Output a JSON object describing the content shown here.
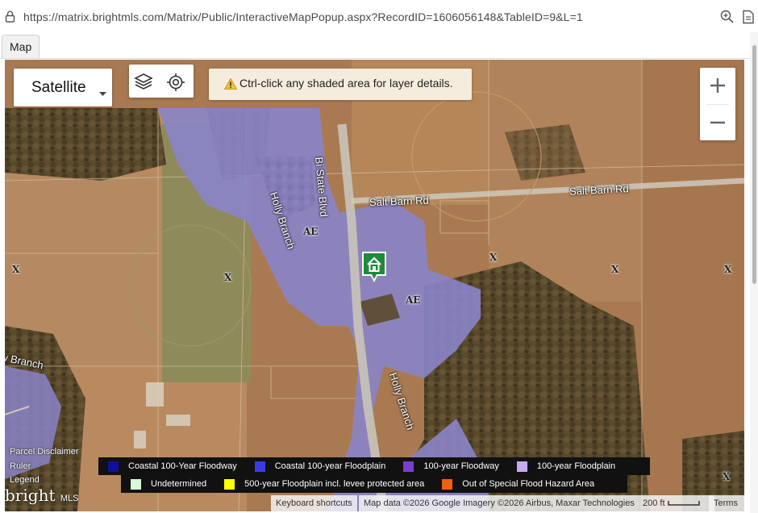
{
  "browser": {
    "url": "https://matrix.brightmls.com/Matrix/Public/InteractiveMapPopup.aspx?RecordID=1606056148&TableID=9&L=1"
  },
  "tabs": [
    {
      "label": "Map",
      "active": true
    }
  ],
  "map": {
    "type_control": {
      "selected": "Satellite"
    },
    "hint": "Ctrl-click any shaded area for layer details.",
    "road_labels": {
      "bi_state": "Bi State Blvd",
      "salt_barn": "Salt Barn Rd",
      "holly_upper": "Holly Branch",
      "holly_lower": "Holly Branch",
      "west_branch": "w Branch"
    },
    "zones": {
      "ae1": "AE",
      "ae2": "AE",
      "x1": "X",
      "x2": "X",
      "x3": "X",
      "x4": "X",
      "x5": "X",
      "x6": "X"
    },
    "side_links": {
      "parcel_disclaimer": "Parcel Disclaimer",
      "ruler": "Ruler",
      "legend": "Legend"
    },
    "legend": [
      {
        "label": "Coastal 100-Year Floodway",
        "color": "#1010a0"
      },
      {
        "label": "Coastal 100-year Floodplain",
        "color": "#3a3ae8"
      },
      {
        "label": "100-year Floodway",
        "color": "#7a3ed0"
      },
      {
        "label": "100-year Floodplain",
        "color": "#c8a8f0"
      },
      {
        "label": "Undetermined",
        "color": "#d8f8d8"
      },
      {
        "label": "500-year Floodplain incl. levee protected area",
        "color": "#ffff00"
      },
      {
        "label": "Out of Special Flood Hazard Area",
        "color": "#f06010"
      }
    ],
    "attribution": {
      "keyboard": "Keyboard shortcuts",
      "data": "Map data ©2026 Google Imagery ©2026 Airbus, Maxar Technologies",
      "scale": "200 ft",
      "terms": "Terms"
    },
    "logo": {
      "name": "bright",
      "suffix": "MLS"
    },
    "colors": {
      "floodplain": "#8a84c8",
      "marker": "#1f8a3a"
    }
  }
}
